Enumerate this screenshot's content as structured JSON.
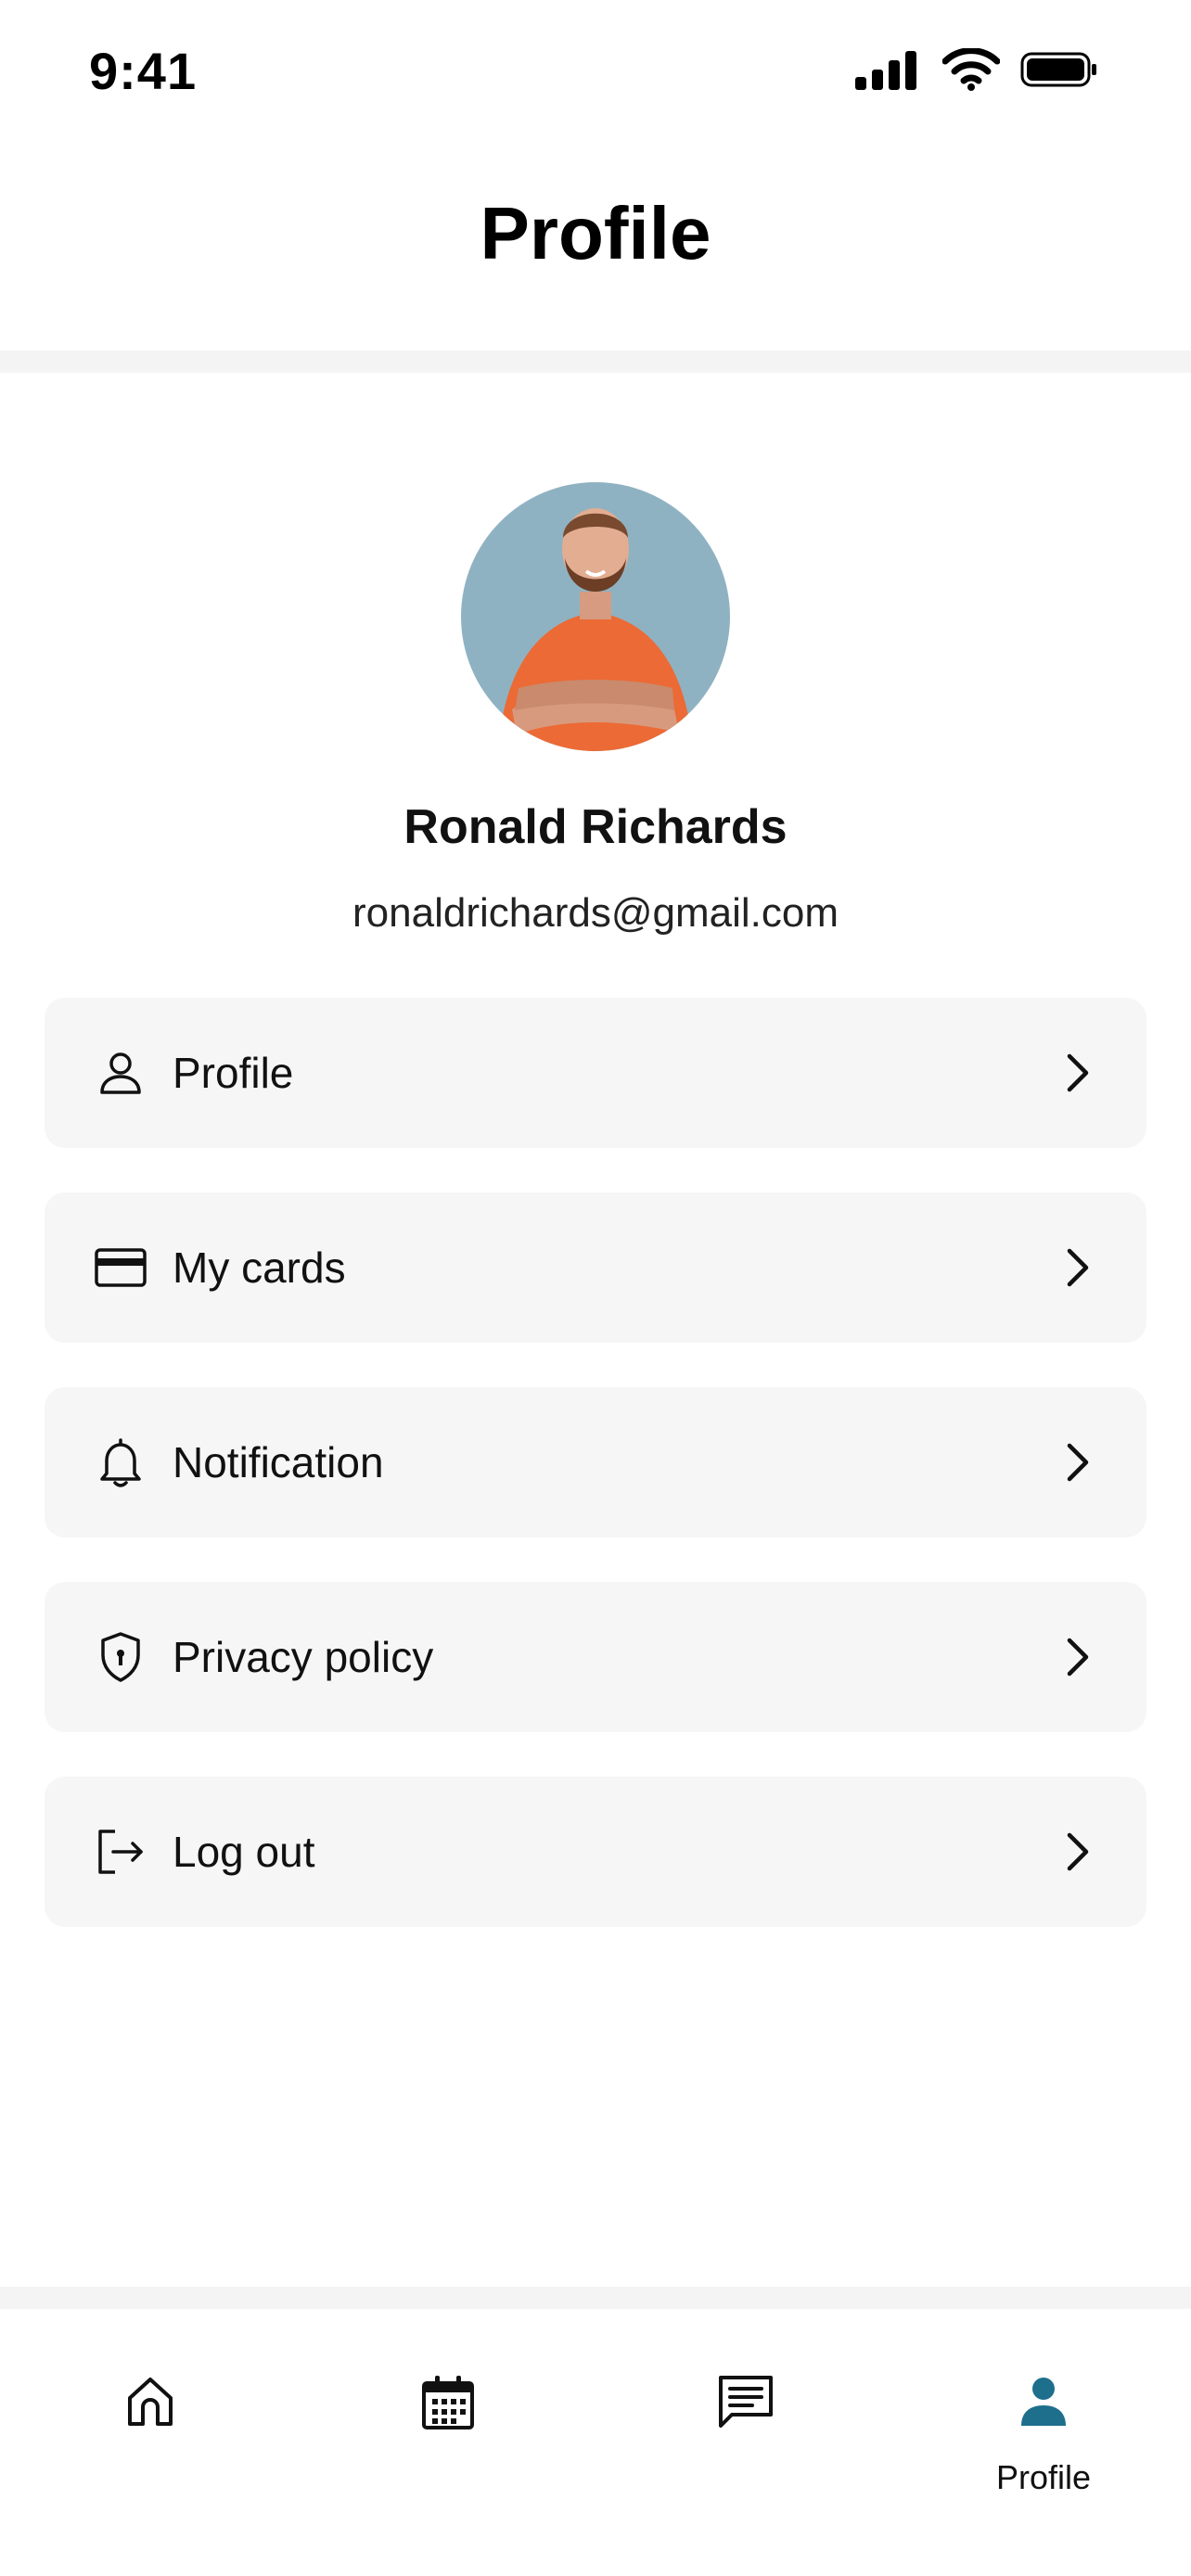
{
  "status_bar": {
    "time": "9:41",
    "icons": [
      "signal-icon",
      "wifi-icon",
      "battery-icon"
    ]
  },
  "header": {
    "title": "Profile"
  },
  "user": {
    "name": "Ronald Richards",
    "email": "ronaldrichards@gmail.com",
    "avatar": "avatar-photo"
  },
  "menu": {
    "items": [
      {
        "label": "Profile",
        "icon": "user-icon"
      },
      {
        "label": "My cards",
        "icon": "credit-card-icon"
      },
      {
        "label": "Notification",
        "icon": "bell-icon"
      },
      {
        "label": "Privacy policy",
        "icon": "shield-icon"
      },
      {
        "label": "Log out",
        "icon": "logout-icon"
      }
    ]
  },
  "tab_bar": {
    "tabs": [
      {
        "icon": "home-icon",
        "label": ""
      },
      {
        "icon": "calendar-icon",
        "label": ""
      },
      {
        "icon": "message-icon",
        "label": ""
      },
      {
        "icon": "profile-icon",
        "label": "Profile",
        "active": true
      }
    ]
  },
  "colors": {
    "accent": "#1e6f8c",
    "card_bg": "#f6f6f6",
    "divider": "#f4f4f4",
    "avatar_bg": "#8fb2c2",
    "shirt": "#ec6a35"
  }
}
